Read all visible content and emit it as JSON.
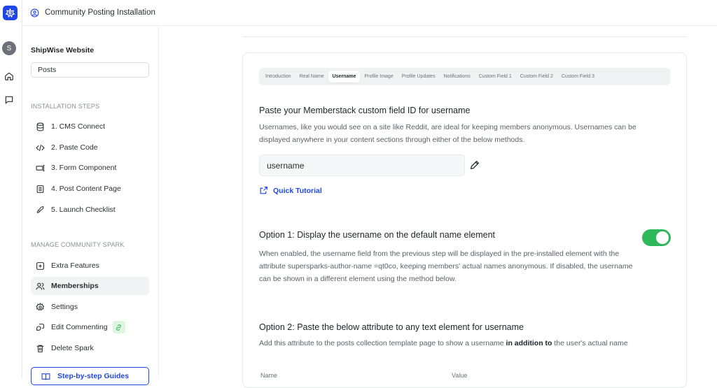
{
  "topbar": {
    "title": "Community Posting Installation"
  },
  "rail": {
    "avatar_letter": "S"
  },
  "sidebar": {
    "site_name": "ShipWise Website",
    "selector_value": "Posts",
    "installation_heading": "INSTALLATION STEPS",
    "installation_steps": [
      {
        "label": "1. CMS Connect",
        "icon": "database-icon"
      },
      {
        "label": "2. Paste Code",
        "icon": "code-icon"
      },
      {
        "label": "3. Form Component",
        "icon": "form-icon"
      },
      {
        "label": "4. Post Content Page",
        "icon": "page-icon"
      },
      {
        "label": "5. Launch Checklist",
        "icon": "rocket-icon"
      }
    ],
    "manage_heading": "MANAGE COMMUNITY SPARK",
    "manage_items": [
      {
        "label": "Extra Features",
        "icon": "plus-square-icon"
      },
      {
        "label": "Memberships",
        "icon": "users-icon",
        "active": true
      },
      {
        "label": "Settings",
        "icon": "gear-icon"
      },
      {
        "label": "Edit Commenting",
        "icon": "comment-icon"
      },
      {
        "label": "Delete Spark",
        "icon": "trash-icon"
      }
    ],
    "guides_button": "Step-by-step Guides"
  },
  "tabs": [
    "Introduction",
    "Real Name",
    "Username",
    "Profile Image",
    "Profile Updates",
    "Notifications",
    "Custom Field 1",
    "Custom Field 2",
    "Custom Field 3"
  ],
  "active_tab": "Username",
  "content": {
    "heading": "Paste your Memberstack custom field ID for username",
    "description": "Usernames, like you would see on a site like Reddit, are ideal for keeping members anonymous. Usernames can be displayed anywhere in your content sections through either of the below methods.",
    "field_value": "username",
    "tutorial_link": "Quick Tutorial",
    "option1_title": "Option 1: Display the username on the default name element",
    "option1_enabled": true,
    "option1_desc": "When enabled, the username field from the previous step will be displayed in the pre-installed element with the attribute supersparks-author-name =qt0co, keeping members' actual names anonymous. If disabled, the username can be shown in a different element using the method below.",
    "option2_title": "Option 2: Paste the below attribute to any text element for username",
    "option2_desc_pre": "Add this attribute to the posts collection template page to show a username ",
    "option2_desc_bold": "in addition to",
    "option2_desc_post": " the user's actual name",
    "col_name": "Name",
    "col_value": "Value"
  },
  "colors": {
    "accent": "#1f46e6",
    "toggle_on": "#2fb85a"
  }
}
